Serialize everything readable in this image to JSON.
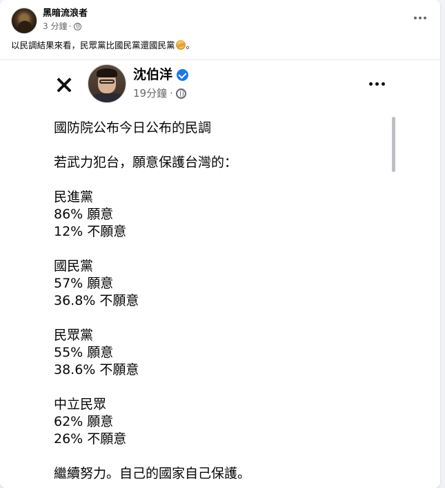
{
  "post": {
    "author": "黑暗流浪者",
    "time": "3 分鐘",
    "sep": "·",
    "text_before": "以民調結果來看，民眾黨比國民黨還國民黨",
    "text_after": "。",
    "emoji": "facepalm-emoji"
  },
  "shared": {
    "author": "沈伯洋",
    "time": "19分鐘",
    "sep": "·",
    "lines": {
      "intro": "國防院公布今日公布的民調",
      "question": "若武力犯台，願意保護台灣的："
    },
    "groups": [
      {
        "party": "民進黨",
        "yes": "86% 願意",
        "no": "12% 不願意"
      },
      {
        "party": "國民黨",
        "yes": "57% 願意",
        "no": "36.8% 不願意"
      },
      {
        "party": "民眾黨",
        "yes": "55% 願意",
        "no": "38.6% 不願意"
      },
      {
        "party": "中立民眾",
        "yes": "62% 願意",
        "no": "26% 不願意"
      }
    ],
    "closing": "繼續努力。自己的國家自己保護。"
  },
  "colors": {
    "accent": "#1877f2",
    "meta": "#65676b",
    "background": "#f0f2f5"
  }
}
